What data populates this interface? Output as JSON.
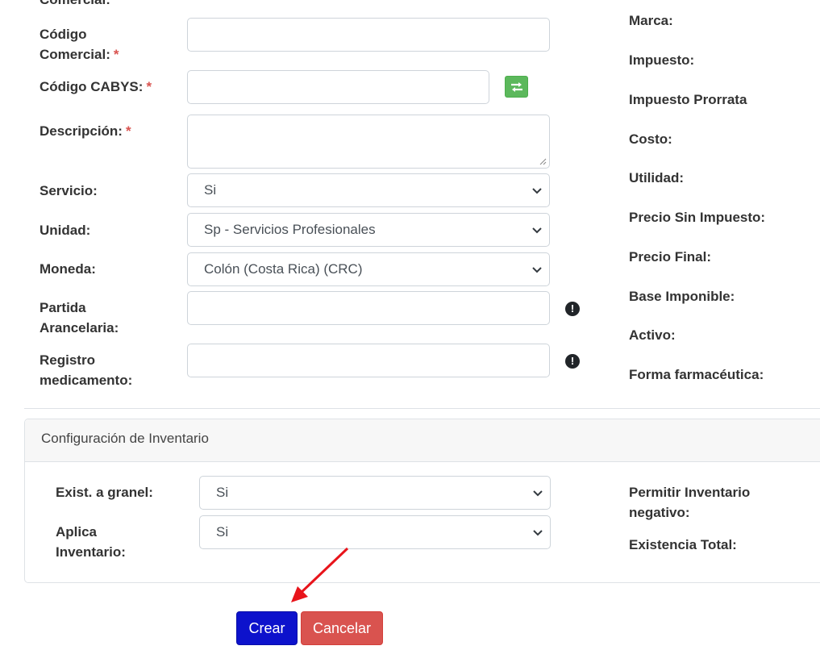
{
  "form": {
    "cut_label": "Comercial:",
    "codigo_comercial": {
      "label_line1": "Código",
      "label_line2": "Comercial:",
      "required": "*",
      "value": ""
    },
    "codigo_cabys": {
      "label": "Código CABYS:",
      "required": "*",
      "value": ""
    },
    "descripcion": {
      "label": "Descripción:",
      "required": "*",
      "value": ""
    },
    "servicio": {
      "label": "Servicio:",
      "selected": "Si"
    },
    "unidad": {
      "label": "Unidad:",
      "selected": "Sp - Servicios Profesionales"
    },
    "moneda": {
      "label": "Moneda:",
      "selected": "Colón (Costa Rica) (CRC)"
    },
    "partida": {
      "label_line1": "Partida",
      "label_line2": "Arancelaria:",
      "value": "",
      "info_icon": "!"
    },
    "registro": {
      "label_line1": "Registro",
      "label_line2": "medicamento:",
      "value": "",
      "info_icon": "!"
    }
  },
  "right_labels": {
    "marca": "Marca:",
    "impuesto": "Impuesto:",
    "impuesto_prorrata": "Impuesto Prorrata",
    "costo": "Costo:",
    "utilidad": "Utilidad:",
    "precio_sin_impuesto": "Precio Sin Impuesto:",
    "precio_final": "Precio Final:",
    "base_imponible": "Base Imponible:",
    "activo": "Activo:",
    "forma_farmaceutica": "Forma farmacéutica:"
  },
  "inventario": {
    "title": "Configuración de Inventario",
    "exist_granel": {
      "label": "Exist. a granel:",
      "selected": "Si"
    },
    "aplica_inventario": {
      "label_line1": "Aplica",
      "label_line2": "Inventario:",
      "selected": "Si"
    },
    "permitir_negativo": {
      "label_line1": "Permitir Inventario",
      "label_line2": "negativo:"
    },
    "existencia_total": {
      "label": "Existencia Total:"
    }
  },
  "actions": {
    "create_label": "Crear",
    "cancel_label": "Cancelar"
  },
  "icons": {
    "swap": "swap-icon",
    "info": "info-icon",
    "chevron": "chevron-down-icon",
    "arrow": "red-arrow-annotation"
  },
  "colors": {
    "create_button": "#0d12cc",
    "cancel_button": "#d9534f",
    "swap_button": "#5cb85c",
    "required_star": "#d9534f",
    "annotation_arrow": "#e8141b"
  }
}
